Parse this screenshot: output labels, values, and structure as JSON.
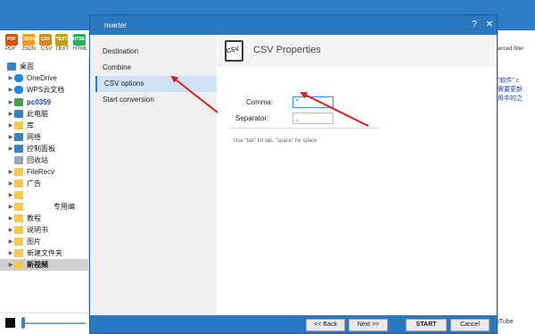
{
  "background": {
    "formats": [
      {
        "label": "PDF",
        "color": "#d35400"
      },
      {
        "label": "JSON",
        "color": "#f39c12"
      },
      {
        "label": "CSV",
        "color": "#d68910"
      },
      {
        "label": "TEXT",
        "color": "#c0a000"
      },
      {
        "label": "HTML",
        "color": "#27ae60"
      }
    ],
    "tree": [
      {
        "label": "桌面",
        "icon": "desktop-icon",
        "expandable": false
      },
      {
        "label": "OneDrive",
        "icon": "cloud-icon",
        "expandable": true
      },
      {
        "label": "WPS云文档",
        "icon": "cloud-icon",
        "expandable": true
      },
      {
        "label": "pc0359",
        "icon": "user-icon",
        "expandable": true
      },
      {
        "label": "此电脑",
        "icon": "computer-icon",
        "expandable": true
      },
      {
        "label": "库",
        "icon": "library-icon",
        "expandable": true
      },
      {
        "label": "网络",
        "icon": "network-icon",
        "expandable": true
      },
      {
        "label": "控制面板",
        "icon": "control-panel-icon",
        "expandable": true
      },
      {
        "label": "回收站",
        "icon": "recycle-bin-icon",
        "expandable": false
      },
      {
        "label": "FileRecv",
        "icon": "folder-icon",
        "expandable": true
      },
      {
        "label": "广告",
        "icon": "folder-icon",
        "expandable": true
      },
      {
        "label": "",
        "icon": "folder-icon",
        "expandable": true
      },
      {
        "label": "专用编",
        "icon": "folder-icon",
        "expandable": true
      },
      {
        "label": "教程",
        "icon": "folder-icon",
        "expandable": true
      },
      {
        "label": "说明书",
        "icon": "folder-icon",
        "expandable": true
      },
      {
        "label": "图片",
        "icon": "folder-icon",
        "expandable": true
      },
      {
        "label": "新建文件夹",
        "icon": "folder-icon",
        "expandable": true
      },
      {
        "label": "新视频",
        "icon": "folder-icon",
        "expandable": true,
        "selected": true
      }
    ],
    "right_filter": "anced filter",
    "right_chinese": [
      "\"软件\" c",
      "需要更新",
      "用中的之"
    ],
    "right_youtube": "uTube"
  },
  "dialog": {
    "title": "nverter",
    "help_label": "?",
    "close_label": "✕",
    "nav": [
      {
        "label": "Destination",
        "active": false
      },
      {
        "label": "Combine",
        "active": false
      },
      {
        "label": "CSV options",
        "active": true
      },
      {
        "label": "Start conversion",
        "active": false
      }
    ],
    "header": {
      "icon_text": "CSV",
      "title": "CSV Properties"
    },
    "fields": {
      "comma_label": "Comma:",
      "comma_value": "\"",
      "separator_label": "Separator:",
      "separator_value": ","
    },
    "hint": "Use \"tab\" for tab, \"space\" for space",
    "buttons": {
      "back": "<< Back",
      "next": "Next >>",
      "start": "START",
      "cancel": "Cancel"
    },
    "accent_color": "#2a77c2",
    "annotation_color": "#d11f1f"
  }
}
